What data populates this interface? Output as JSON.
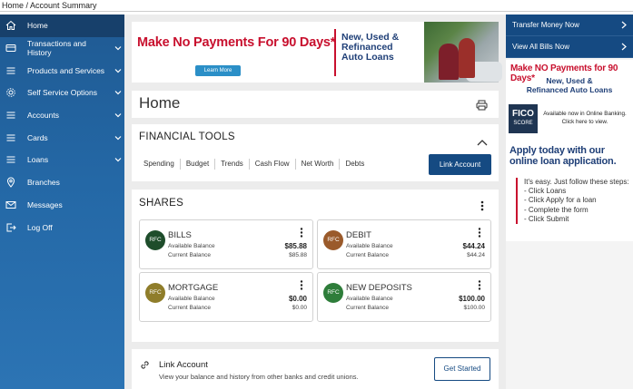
{
  "breadcrumb": "Home / Account Summary",
  "sidebar": {
    "items": [
      {
        "label": "Home",
        "icon": "home-icon"
      },
      {
        "label": "Transactions and History",
        "icon": "card-icon"
      },
      {
        "label": "Products and Services",
        "icon": "menu-icon"
      },
      {
        "label": "Self Service Options",
        "icon": "gear-icon"
      },
      {
        "label": "Accounts",
        "icon": "menu-icon"
      },
      {
        "label": "Cards",
        "icon": "menu-icon"
      },
      {
        "label": "Loans",
        "icon": "menu-icon"
      },
      {
        "label": "Branches",
        "icon": "location-icon"
      },
      {
        "label": "Messages",
        "icon": "mail-icon"
      },
      {
        "label": "Log Off",
        "icon": "logout-icon"
      }
    ]
  },
  "banner": {
    "headline": "Make No Payments For 90 Days*",
    "line1": "New, Used &",
    "line2": "Refinanced",
    "line3": "Auto Loans",
    "learn_more": "Learn More"
  },
  "page_title": "Home",
  "financial_tools": {
    "title": "FINANCIAL TOOLS",
    "tabs": [
      "Spending",
      "Budget",
      "Trends",
      "Cash Flow",
      "Net Worth",
      "Debts"
    ],
    "link_account_button": "Link Account"
  },
  "shares": {
    "title": "SHARES",
    "accounts": [
      {
        "avatar": "RFC",
        "name": "BILLS",
        "available_label": "Available Balance",
        "available": "$85.88",
        "current_label": "Current Balance",
        "current": "$85.88",
        "color": "#1e4d2b"
      },
      {
        "avatar": "RFC",
        "name": "DEBIT",
        "available_label": "Available Balance",
        "available": "$44.24",
        "current_label": "Current Balance",
        "current": "$44.24",
        "color": "#9a5a2b"
      },
      {
        "avatar": "RFC",
        "name": "MORTGAGE",
        "available_label": "Available Balance",
        "available": "$0.00",
        "current_label": "Current Balance",
        "current": "$0.00",
        "color": "#8f7d2a"
      },
      {
        "avatar": "RFC",
        "name": "NEW DEPOSITS",
        "available_label": "Available Balance",
        "available": "$100.00",
        "current_label": "Current Balance",
        "current": "$100.00",
        "color": "#2e7d3a"
      }
    ]
  },
  "link_account_card": {
    "title": "Link Account",
    "description": "View your balance and history from other banks and credit unions.",
    "button": "Get Started"
  },
  "right_panel": {
    "items": [
      "Transfer Money Now",
      "View All Bills Now"
    ],
    "ad": {
      "headline": "Make NO Payments for 90 Days*",
      "line1": "New, Used &",
      "line2": "Refinanced Auto Loans",
      "fico_top": "FICO",
      "fico_bottom": "SCORE",
      "fico_text1": "Available now in Online Banking.",
      "fico_text2": "Click here to view.",
      "apply": "Apply today with our online loan application.",
      "steps_intro": "It's easy. Just follow these steps:",
      "steps": [
        "- Click Loans",
        "- Click Apply for a loan",
        "- Complete the form",
        "- Click Submit"
      ]
    }
  }
}
